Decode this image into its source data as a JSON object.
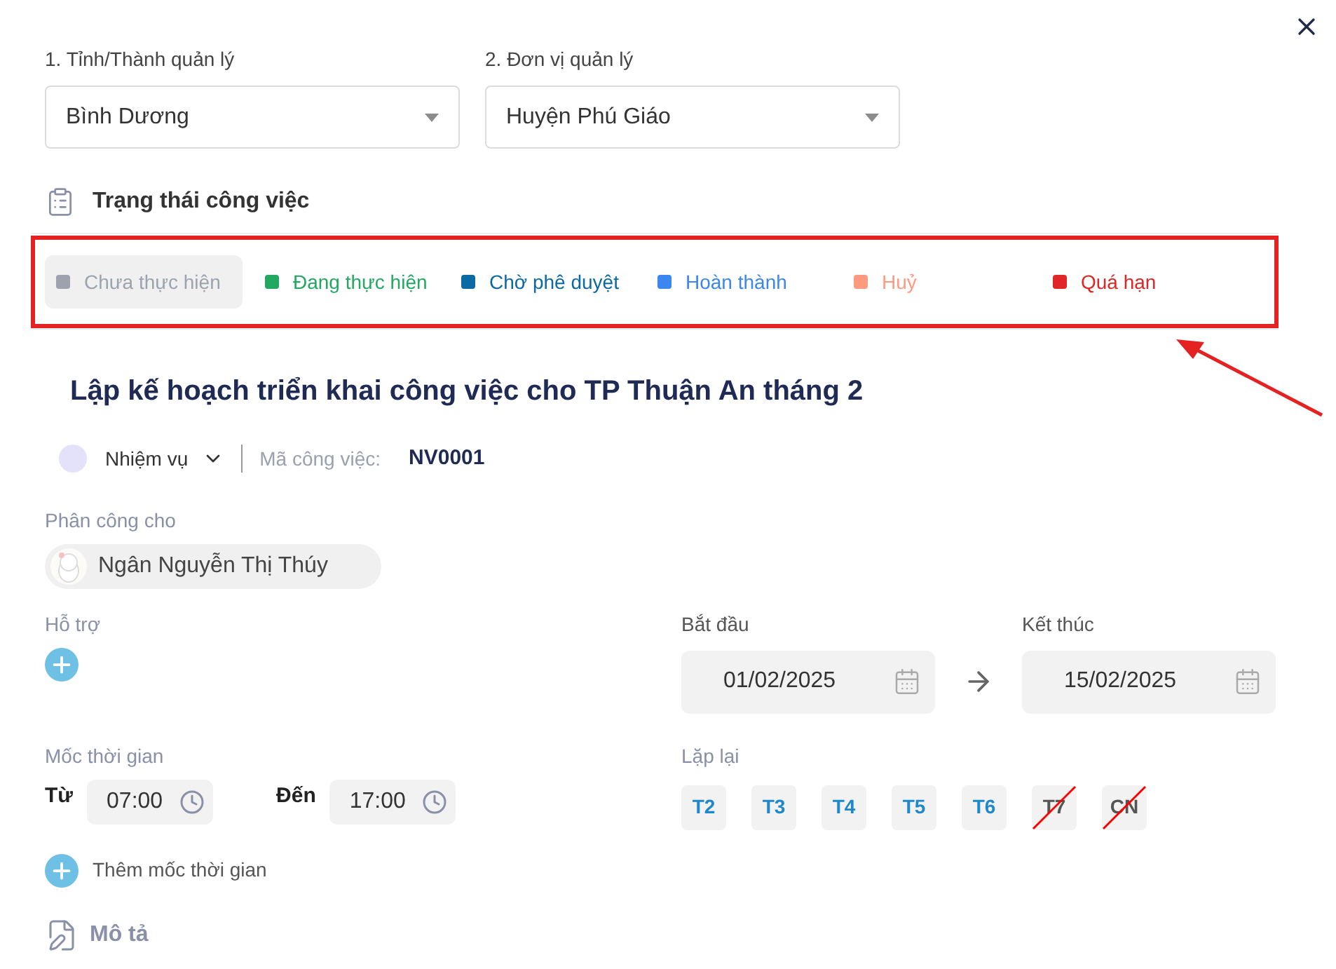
{
  "filters": [
    {
      "label": "1. Tỉnh/Thành quản lý",
      "value": "Bình Dương"
    },
    {
      "label": "2. Đơn vị quản lý",
      "value": "Huyện Phú Giáo"
    }
  ],
  "status_section": {
    "title": "Trạng thái công việc",
    "statuses": [
      {
        "label": "Chưa thực hiện",
        "color": "#9ca3af",
        "selected": true
      },
      {
        "label": "Đang thực hiện",
        "color": "#22a861",
        "selected": false
      },
      {
        "label": "Chờ phê duyệt",
        "color": "#0b69a3",
        "selected": false
      },
      {
        "label": "Hoàn thành",
        "color": "#3b86f0",
        "selected": false
      },
      {
        "label": "Huỷ",
        "color": "#ff9a80",
        "selected": false
      },
      {
        "label": "Quá hạn",
        "color": "#e02626",
        "selected": false
      }
    ]
  },
  "task": {
    "title": "Lập kế hoạch triển khai công việc cho TP Thuận An tháng 2",
    "type": "Nhiệm vụ",
    "code_label": "Mã công việc:",
    "code": "NV0001"
  },
  "assign": {
    "label": "Phân công cho",
    "assignee": "Ngân Nguyễn Thị Thúy"
  },
  "support": {
    "label": "Hỗ trợ"
  },
  "start": {
    "label": "Bắt đầu",
    "value": "01/02/2025"
  },
  "end": {
    "label": "Kết thúc",
    "value": "15/02/2025"
  },
  "milestone": {
    "label": "Mốc thời gian",
    "from_label": "Từ",
    "from": "07:00",
    "to_label": "Đến",
    "to": "17:00",
    "add": "Thêm mốc thời gian"
  },
  "repeat": {
    "label": "Lặp lại",
    "days": [
      {
        "label": "T2",
        "enabled": true
      },
      {
        "label": "T3",
        "enabled": true
      },
      {
        "label": "T4",
        "enabled": true
      },
      {
        "label": "T5",
        "enabled": true
      },
      {
        "label": "T6",
        "enabled": true
      },
      {
        "label": "T7",
        "enabled": false
      },
      {
        "label": "CN",
        "enabled": false
      }
    ]
  },
  "description": {
    "title": "Mô tả"
  }
}
